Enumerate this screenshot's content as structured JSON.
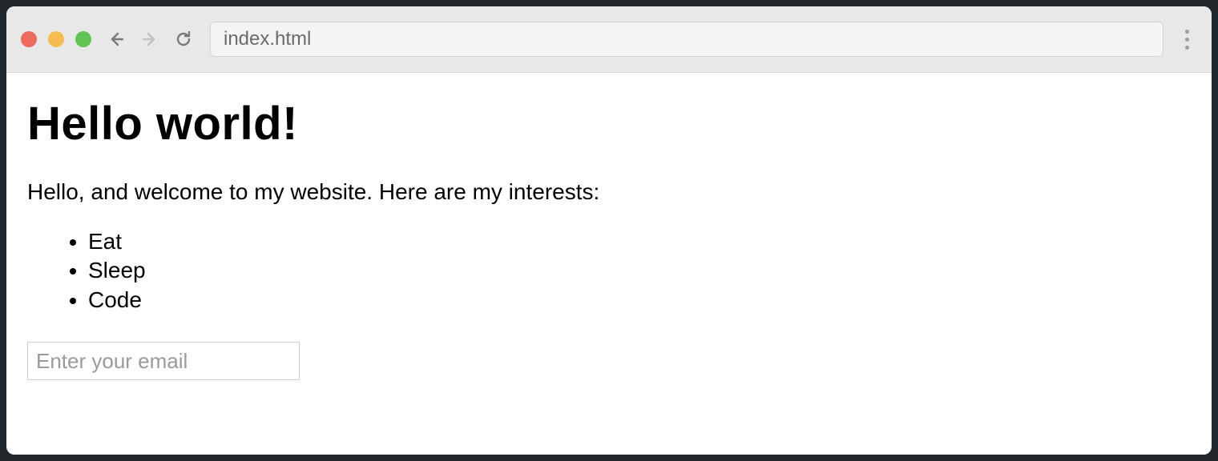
{
  "browser": {
    "url": "index.html"
  },
  "page": {
    "heading": "Hello world!",
    "intro": "Hello, and welcome to my website. Here are my interests:",
    "interests": [
      "Eat",
      "Sleep",
      "Code"
    ],
    "email_placeholder": "Enter your email",
    "email_value": ""
  }
}
